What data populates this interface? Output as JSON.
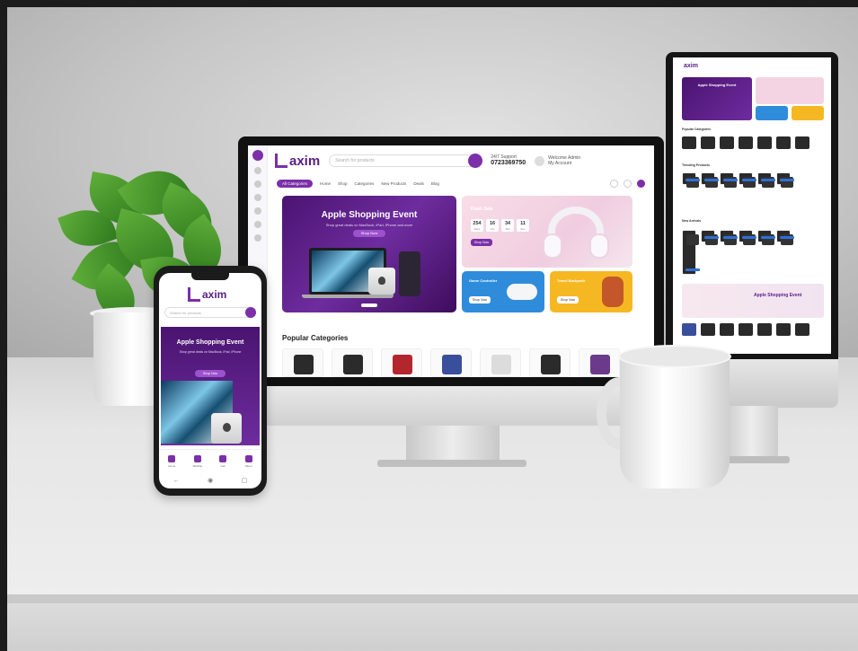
{
  "brand": {
    "logo_text": "axim",
    "accent": "#7b2fa8",
    "dark_accent": "#5a1e86"
  },
  "desktop": {
    "search_placeholder": "Search for products",
    "support": {
      "label": "24/7 Support",
      "phone": "0723369750"
    },
    "account": {
      "label": "Welcome Admin",
      "sub": "My Account"
    },
    "nav": {
      "category_button": "All Categories",
      "links": [
        "Home",
        "Shop",
        "Categories",
        "New Products",
        "Deals",
        "Blog"
      ]
    },
    "hero": {
      "title": "Apple Shopping Event",
      "subtitle": "Shop great deals on MacBook, iPad, iPhone and more",
      "button": "Shop Now"
    },
    "flash_promo": {
      "title": "Flash Sale",
      "countdown": [
        {
          "value": "254",
          "unit": "Days"
        },
        {
          "value": "16",
          "unit": "Hrs"
        },
        {
          "value": "34",
          "unit": "Min"
        },
        {
          "value": "11",
          "unit": "Sec"
        }
      ],
      "button": "Shop Now"
    },
    "promo_blue": {
      "title": "Game Controller",
      "button": "Shop Now"
    },
    "promo_orange": {
      "title": "Travel Backpack",
      "button": "Shop Now"
    },
    "popular_title": "Popular Categories"
  },
  "mobile": {
    "search_placeholder": "Search for products",
    "hero": {
      "title": "Apple Shopping Event",
      "subtitle": "Shop great deals on MacBook, iPad, iPhone",
      "button": "Shop Now"
    },
    "tabbar": [
      "Home",
      "Wishlist",
      "Cart",
      "Menu"
    ]
  },
  "tall_monitor": {
    "logo_text": "axim",
    "hero_title": "Apple Shopping Event",
    "section_labels": [
      "Popular Categories",
      "Trending Products",
      "New Arrivals"
    ],
    "banner_title": "Apple Shopping Event"
  }
}
